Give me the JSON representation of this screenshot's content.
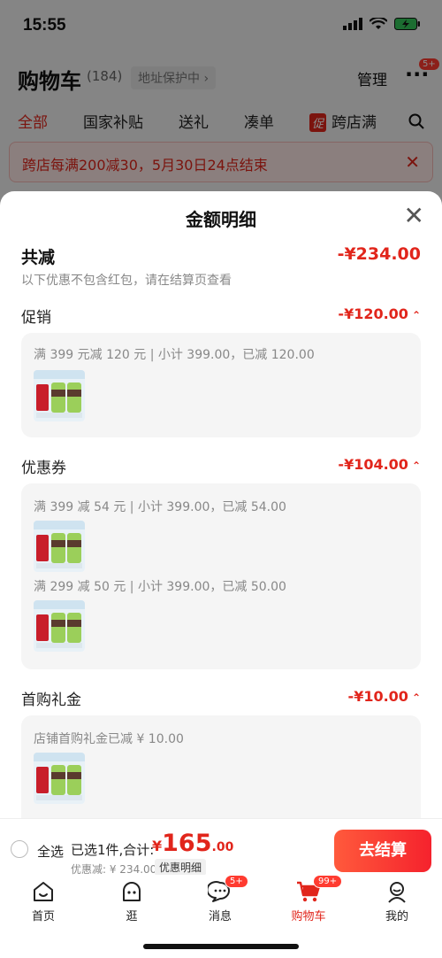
{
  "status": {
    "time": "15:55"
  },
  "cart_header": {
    "title": "购物车",
    "count": "(184)",
    "address": "地址保护中 ›",
    "manage": "管理",
    "more_badge": "5+"
  },
  "filter_tabs": [
    {
      "label": "全部",
      "active": true
    },
    {
      "label": "国家补贴"
    },
    {
      "label": "送礼"
    },
    {
      "label": "凑单"
    },
    {
      "label": "跨店满",
      "tag": "促"
    }
  ],
  "promo_banner": {
    "text": "跨店每满200减30，5月30日24点结束"
  },
  "sheet": {
    "title": "金额明细",
    "total_label": "共减",
    "total_amount": "-¥234.00",
    "total_note": "以下优惠不包含红包，请在结算页查看",
    "sections": {
      "promo": {
        "title": "促销",
        "amount": "-¥120.00",
        "lines": [
          "满 399 元减 120 元 | 小计 399.00，已减 120.00"
        ]
      },
      "coupon": {
        "title": "优惠券",
        "amount": "-¥104.00",
        "lines": [
          "满 399 减 54 元 | 小计 399.00，已减 54.00",
          "满 299 减 50 元 | 小计 399.00，已减 50.00"
        ]
      },
      "first_gift": {
        "title": "首购礼金",
        "amount": "-¥10.00",
        "lines": [
          "店铺首购礼金已减 ¥ 10.00"
        ]
      }
    }
  },
  "checkout": {
    "select_all": "全选",
    "selected_summary": "已选1件,合计:",
    "price_symbol": "¥",
    "price_int": "165",
    "price_dec": ".00",
    "discount_line": "优惠减: ¥ 234.00",
    "detail_chip": "优惠明细",
    "button": "去结算"
  },
  "tabbar": [
    {
      "label": "首页",
      "icon": "home-face-icon"
    },
    {
      "label": "逛",
      "icon": "explore-face-icon"
    },
    {
      "label": "消息",
      "icon": "message-icon",
      "badge": "5+"
    },
    {
      "label": "购物车",
      "icon": "cart-icon",
      "badge": "99+",
      "active": true
    },
    {
      "label": "我的",
      "icon": "profile-icon"
    }
  ],
  "colors": {
    "accent": "#e1251b",
    "sheet_bg": "#ffffff",
    "card_bg": "#f5f5f5"
  }
}
